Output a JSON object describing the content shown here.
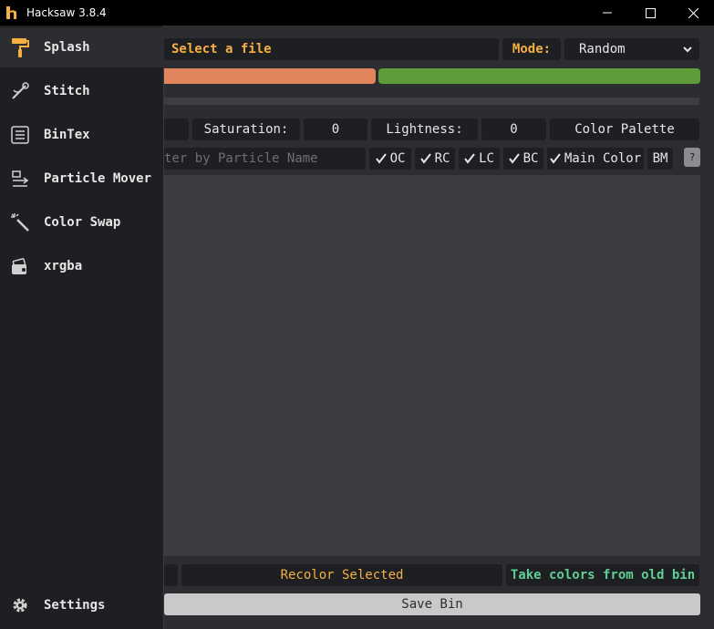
{
  "window": {
    "title": "Hacksaw 3.8.4"
  },
  "sidebar": {
    "items": [
      {
        "label": "Splash",
        "icon": "paint-roller-icon",
        "active": true
      },
      {
        "label": "Stitch",
        "icon": "stitch-needle-icon"
      },
      {
        "label": "BinTex",
        "icon": "list-icon"
      },
      {
        "label": "Particle Mover",
        "icon": "particle-move-icon"
      },
      {
        "label": "Color Swap",
        "icon": "magic-wand-icon"
      },
      {
        "label": "xrgba",
        "icon": "image-palette-icon"
      }
    ],
    "settings": {
      "label": "Settings",
      "icon": "gear-icon"
    }
  },
  "toolbar": {
    "select_file": "Select a file",
    "mode_label": "Mode:",
    "mode_value": "Random"
  },
  "colors": {
    "bar_orange": "#e0855c",
    "bar_green": "#5e9c3a",
    "accent": "#f5b041",
    "take_colors": "#5fcf94"
  },
  "hsl": {
    "saturation_label": "Saturation:",
    "saturation_value": "0",
    "lightness_label": "Lightness:",
    "lightness_value": "0",
    "palette_label": "Color Palette"
  },
  "filter": {
    "placeholder": "ter by Particle Name",
    "checkboxes": [
      {
        "label": "OC",
        "checked": true
      },
      {
        "label": "RC",
        "checked": true
      },
      {
        "label": "LC",
        "checked": true
      },
      {
        "label": "BC",
        "checked": true
      },
      {
        "label": "Main Color",
        "checked": true
      }
    ],
    "bm_label": "BM",
    "help_label": "?"
  },
  "actions": {
    "recolor_label": "Recolor Selected",
    "take_colors_label": "Take colors from old bin",
    "save_label": "Save Bin"
  }
}
